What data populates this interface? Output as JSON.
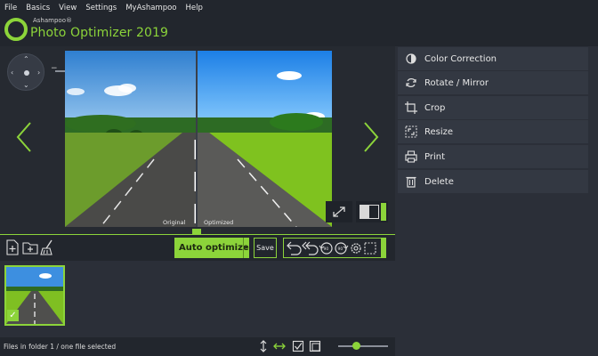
{
  "menu": [
    "File",
    "Basics",
    "View",
    "Settings",
    "MyAshampoo",
    "Help"
  ],
  "brand": {
    "small": "Ashampoo®",
    "name": "Photo Optimizer 2019"
  },
  "viewer": {
    "caption_original": "Original",
    "caption_optimized": "Optimized"
  },
  "actions": [
    {
      "label": "Color Correction",
      "icon": "color-correction-icon"
    },
    {
      "label": "Rotate / Mirror",
      "icon": "rotate-icon"
    },
    {
      "label": "Crop",
      "icon": "crop-icon"
    },
    {
      "label": "Resize",
      "icon": "resize-icon"
    },
    {
      "label": "Print",
      "icon": "print-icon"
    },
    {
      "label": "Delete",
      "icon": "trash-icon"
    }
  ],
  "toolbar": {
    "auto_optimize": "Auto optimize",
    "save": "Save"
  },
  "status": {
    "text": "Files in folder 1 / one file selected"
  },
  "colors": {
    "accent": "#8cd43a",
    "panel": "#2b2f38",
    "dark": "#22262d"
  }
}
